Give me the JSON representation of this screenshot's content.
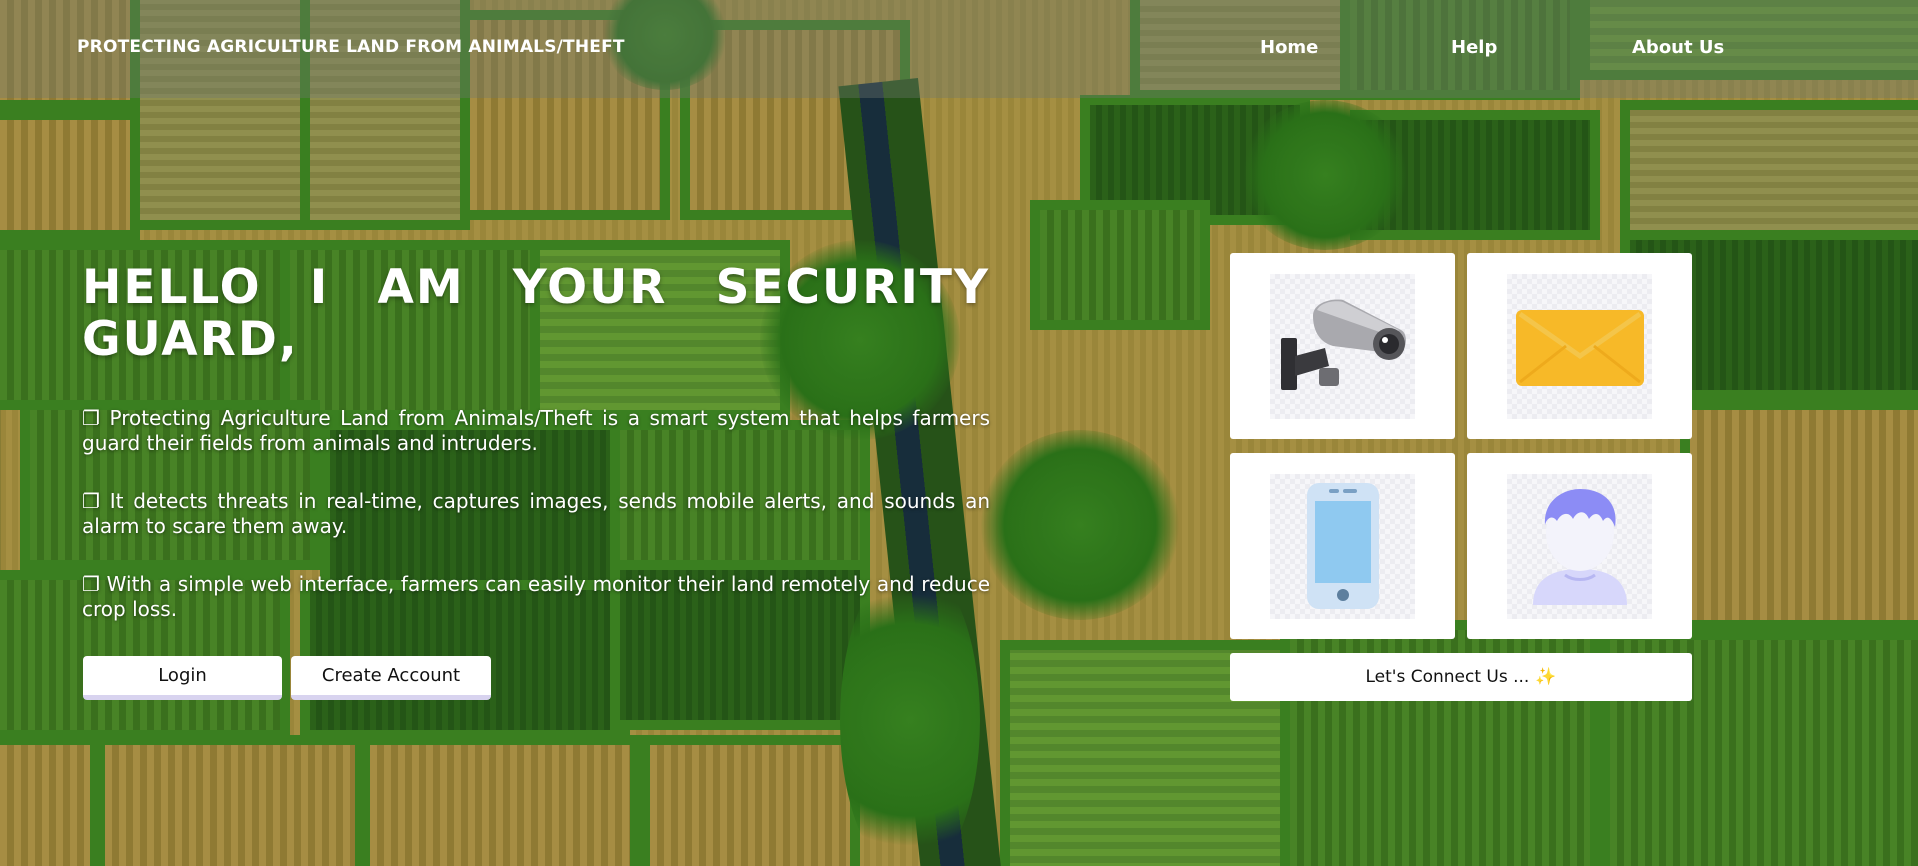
{
  "header": {
    "brand": "PROTECTING AGRICULTURE LAND FROM ANIMALS/THEFT",
    "nav": [
      {
        "label": "Home"
      },
      {
        "label": "Help"
      },
      {
        "label": "About Us"
      }
    ]
  },
  "hero": {
    "title": "HELLO I AM YOUR SECURITY GUARD,",
    "bullet_glyph": "❐",
    "paragraphs": [
      "Protecting Agriculture Land from Animals/Theft is a smart system that helps farmers guard their fields from animals and intruders.",
      "It detects threats in real-time, captures images, sends mobile alerts, and sounds an alarm to scare them away.",
      "With a simple web interface, farmers can easily monitor their land remotely and reduce crop loss."
    ],
    "buttons": {
      "login": "Login",
      "create_account": "Create Account"
    }
  },
  "cards": [
    {
      "icon": "security-camera-icon"
    },
    {
      "icon": "envelope-icon"
    },
    {
      "icon": "smartphone-icon"
    },
    {
      "icon": "user-avatar-icon"
    }
  ],
  "connect": {
    "label": "Let's Connect Us ...",
    "emoji": "✨"
  },
  "colors": {
    "envelope": "#f7b928",
    "phone_screen": "#8fc9f0",
    "avatar": "#8c8cf5",
    "button_shadow": "#d8d3ef"
  }
}
